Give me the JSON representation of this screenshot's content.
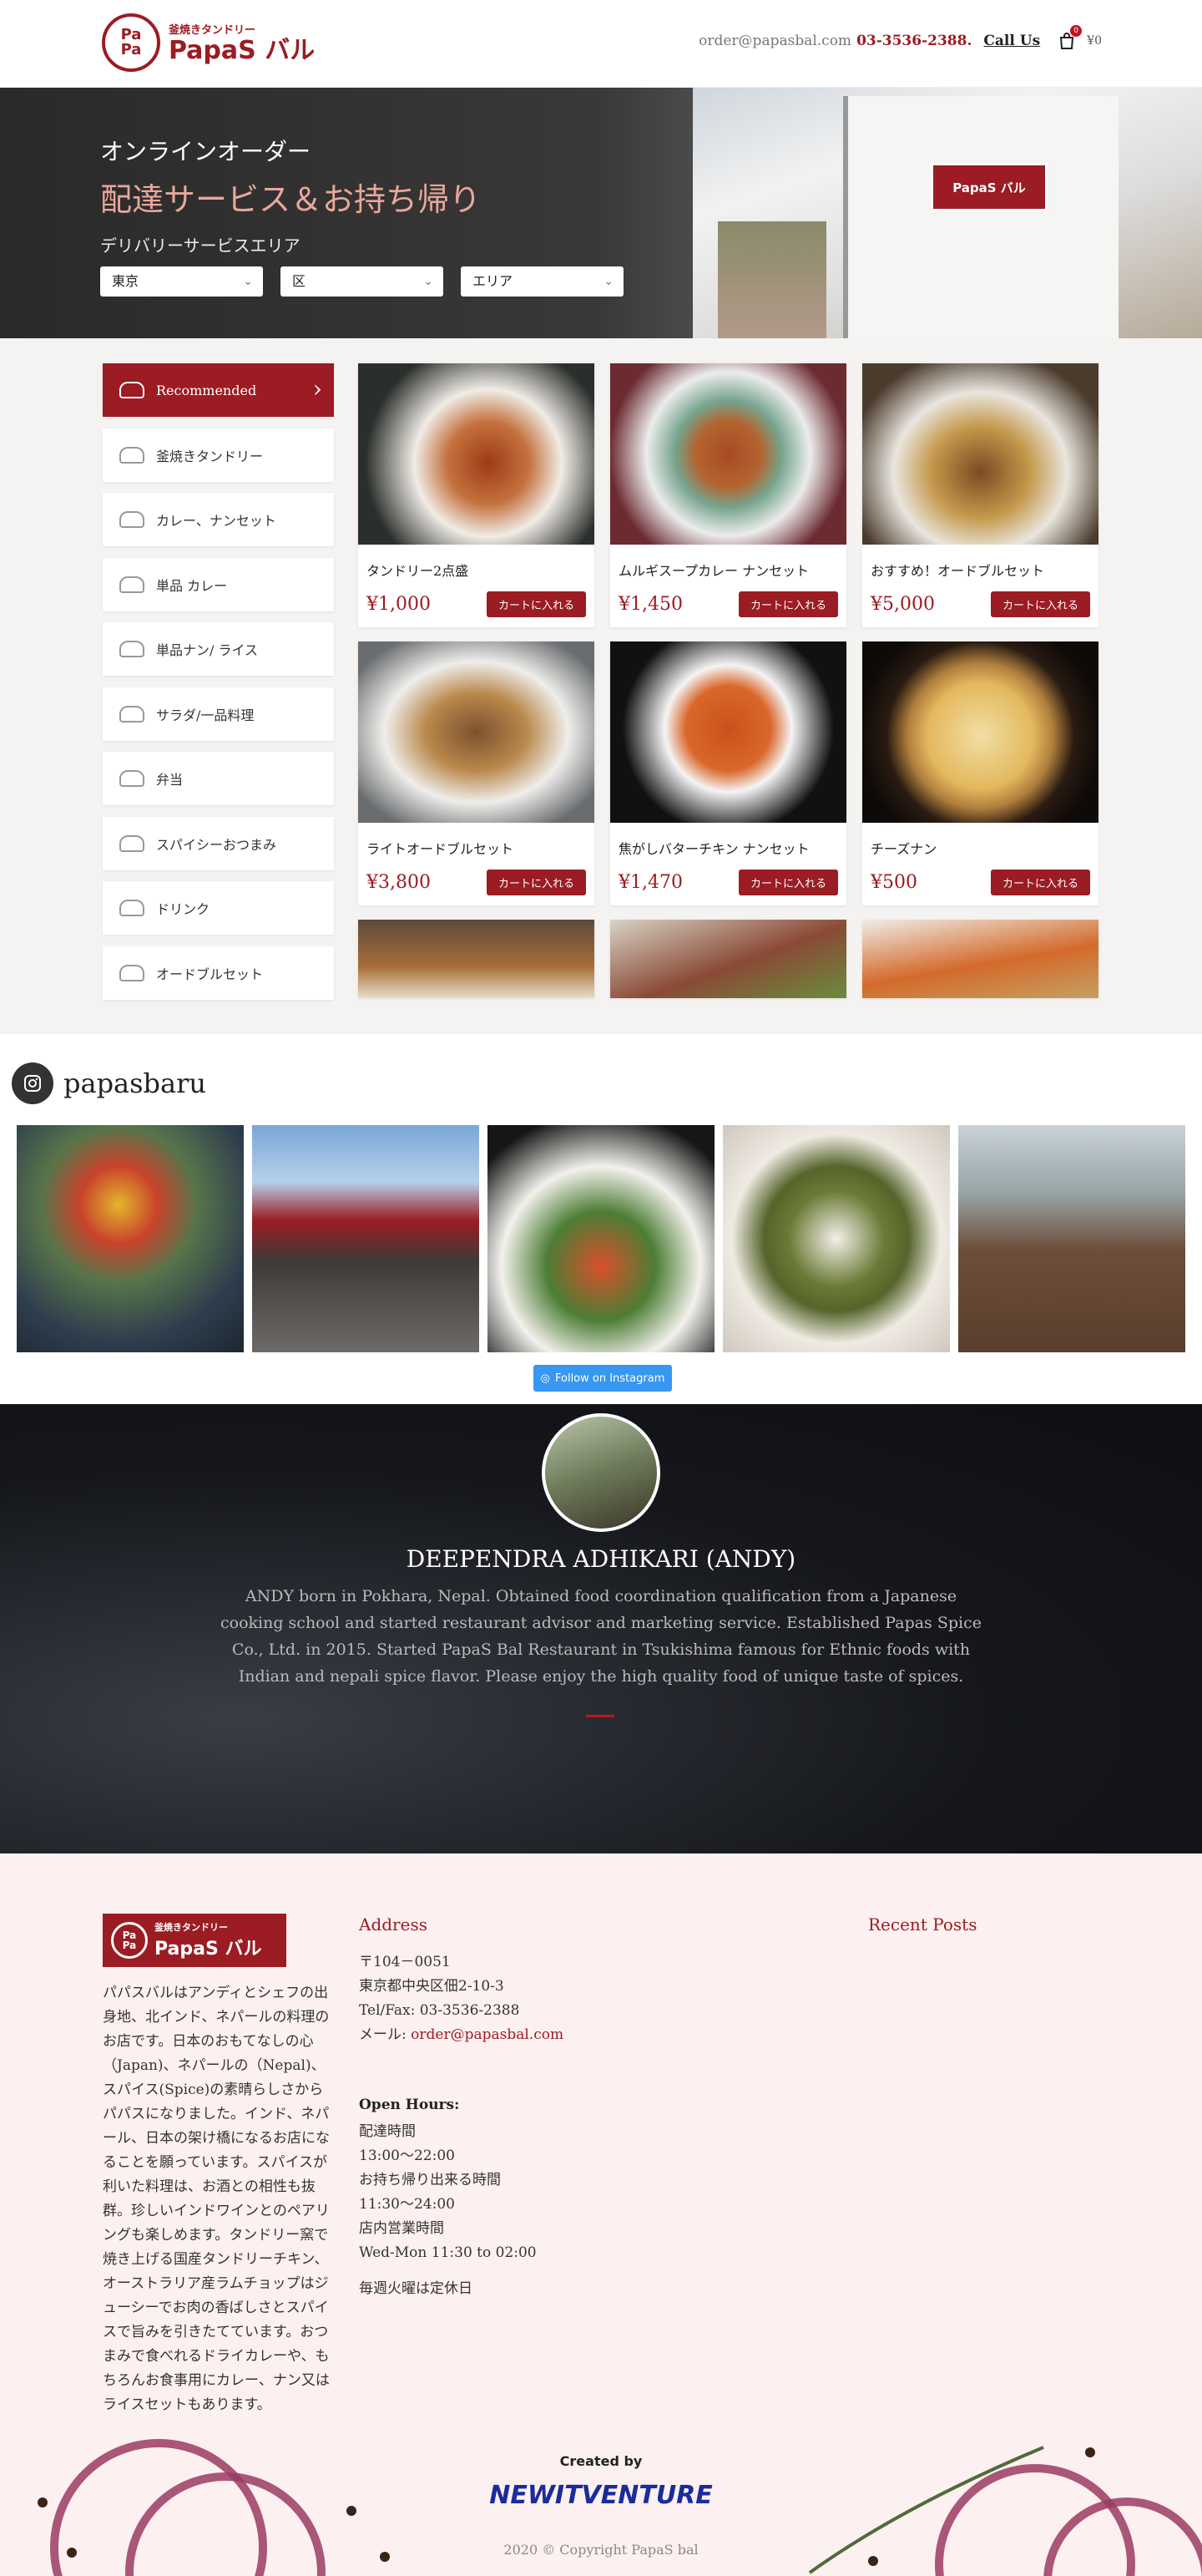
{
  "header": {
    "logo_top": "Pa",
    "logo_bottom": "Pa",
    "logo_sub": "釜焼きタンドリー",
    "logo_main": "PapaS バル",
    "email": "order@papasbal.com",
    "phone": "03-3536-2388.",
    "call_us": "Call Us",
    "cart_count": "0",
    "cart_total": "¥0"
  },
  "hero": {
    "kicker": "オンラインオーダー",
    "title": "配達サービス＆お持ち帰り",
    "area_label": "デリバリーサービスエリア",
    "selects": [
      "東京",
      "区",
      "エリア"
    ],
    "sign_text": "PapaS バル"
  },
  "categories": [
    {
      "label": "Recommended",
      "active": true
    },
    {
      "label": "釜焼きタンドリー"
    },
    {
      "label": "カレー、ナンセット"
    },
    {
      "label": "単品 カレー"
    },
    {
      "label": "単品ナン/ ライス"
    },
    {
      "label": "サラダ/一品料理"
    },
    {
      "label": "弁当"
    },
    {
      "label": "スパイシーおつまみ"
    },
    {
      "label": "ドリンク"
    },
    {
      "label": "オードブルセット"
    }
  ],
  "products": [
    {
      "name": "タンドリー2点盛",
      "price": "¥1,000",
      "button": "カートに入れる"
    },
    {
      "name": "ムルギスープカレー ナンセット",
      "price": "¥1,450",
      "button": "カートに入れる"
    },
    {
      "name": "おすすめ！オードブルセット",
      "price": "¥5,000",
      "button": "カートに入れる"
    },
    {
      "name": "ライトオードブルセット",
      "price": "¥3,800",
      "button": "カートに入れる"
    },
    {
      "name": "焦がしバターチキン ナンセット",
      "price": "¥1,470",
      "button": "カートに入れる"
    },
    {
      "name": "チーズナン",
      "price": "¥500",
      "button": "カートに入れる"
    }
  ],
  "instagram": {
    "handle": "papasbaru",
    "follow": "Follow on Instagram"
  },
  "about": {
    "name": "DEEPENDRA ADHIKARI (ANDY)",
    "bio": "ANDY born in Pokhara, Nepal. Obtained food coordination qualification from a Japanese cooking school and started restaurant advisor and marketing service. Established Papas Spice Co., Ltd. in 2015. Started PapaS Bal Restaurant in Tsukishima famous for Ethnic foods with Indian and nepali spice flavor. Please enjoy the high quality food of unique taste of spices."
  },
  "footer": {
    "logo_sub": "釜焼きタンドリー",
    "logo_main": "PapaS バル",
    "about_text": "パパスバルはアンディとシェフの出身地、北インド、ネパールの料理のお店です。日本のおもてなしの心（Japan)、ネパールの（Nepal)、スパイス(Spice)の素晴らしさから パパスになりました。インド、ネパール、日本の架け橋になるお店になることを願っています。スパイスが利いた料理は、お酒との相性も抜群。珍しいインドワインとのペアリングも楽しめます。タンドリー窯で焼き上げる国産タンドリーチキン、オーストラリア産ラムチョップはジューシーでお肉の香ばしさとスパイスで旨みを引きたてています。おつまみで食べれるドライカレーや、もちろんお食事用にカレー、ナン又はライスセットもあります。",
    "address_heading": "Address",
    "postal": "〒104－0051",
    "address": "東京都中央区佃2-10-3",
    "tel": "Tel/Fax: 03-3536-2388",
    "mail_label": "メール: ",
    "mail": "order@papasbal.com",
    "hours_heading": "Open Hours:",
    "hours": [
      "配達時間",
      "13:00～22:00",
      "お持ち帰り出来る時間",
      "11:30～24:00",
      "店内営業時間",
      "Wed-Mon 11:30 to 02:00"
    ],
    "closed": "毎週火曜は定休日",
    "recent_heading": "Recent Posts",
    "created_by": "Created by",
    "creator": "NEWITVENTURE",
    "copyright": "2020 © Copyright PapaS bal"
  },
  "colors": {
    "brand": "#9b1c23",
    "instagram": "#3897f0",
    "footer_bg": "#fdf0f0"
  }
}
